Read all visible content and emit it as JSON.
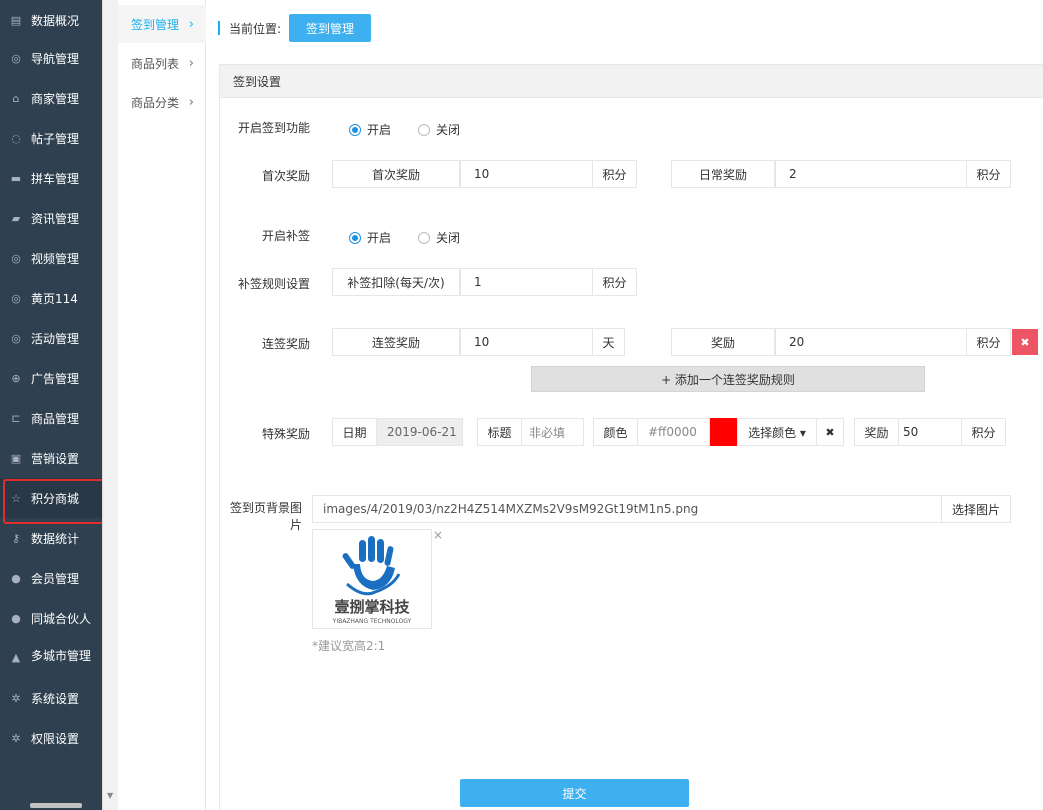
{
  "sidebar": {
    "items": [
      {
        "label": "数据概况",
        "icon": "dashboard-icon"
      },
      {
        "label": "导航管理",
        "icon": "compass-icon"
      },
      {
        "label": "商家管理",
        "icon": "bank-icon"
      },
      {
        "label": "帖子管理",
        "icon": "comment-icon"
      },
      {
        "label": "拼车管理",
        "icon": "car-icon"
      },
      {
        "label": "资讯管理",
        "icon": "book-icon"
      },
      {
        "label": "视频管理",
        "icon": "compass-icon"
      },
      {
        "label": "黄页114",
        "icon": "compass-icon"
      },
      {
        "label": "活动管理",
        "icon": "compass-icon"
      },
      {
        "label": "广告管理",
        "icon": "lifebuoy-icon"
      },
      {
        "label": "商品管理",
        "icon": "cart-icon"
      },
      {
        "label": "营销设置",
        "icon": "gift-icon"
      },
      {
        "label": "积分商城",
        "icon": "star-icon"
      },
      {
        "label": "数据统计",
        "icon": "key-icon"
      },
      {
        "label": "会员管理",
        "icon": "user-icon"
      },
      {
        "label": "同城合伙人",
        "icon": "users-icon"
      },
      {
        "label": "多城市管理",
        "icon": "graduation-icon"
      },
      {
        "label": "系统设置",
        "icon": "gear-icon"
      },
      {
        "label": "权限设置",
        "icon": "gear-icon"
      }
    ]
  },
  "subnav": {
    "items": [
      {
        "label": "签到管理"
      },
      {
        "label": "商品列表"
      },
      {
        "label": "商品分类"
      }
    ]
  },
  "crumb": {
    "label": "当前位置:",
    "current": "签到管理"
  },
  "panel": {
    "title": "签到设置"
  },
  "form": {
    "sign_enable": {
      "label": "开启签到功能",
      "on": "开启",
      "off": "关闭"
    },
    "first_reward": {
      "label": "首次奖励",
      "addon": "首次奖励",
      "value": "10",
      "unit": "积分"
    },
    "daily_reward": {
      "addon": "日常奖励",
      "value": "2",
      "unit": "积分"
    },
    "makeup_enable": {
      "label": "开启补签",
      "on": "开启",
      "off": "关闭"
    },
    "makeup_rule": {
      "label": "补签规则设置",
      "addon": "补签扣除(每天/次)",
      "value": "1",
      "unit": "积分"
    },
    "streak": {
      "label": "连签奖励",
      "addon": "连签奖励",
      "days": "10",
      "days_unit": "天",
      "reward_addon": "奖励",
      "reward": "20",
      "reward_unit": "积分",
      "delete": "✖"
    },
    "add_rule": "+ 添加一个连签奖励规则",
    "special": {
      "label": "特殊奖励",
      "date_addon": "日期",
      "date": "2019-06-21",
      "title_addon": "标题",
      "title_placeholder": "非必填",
      "color_addon": "颜色",
      "color_value": "#ff0000",
      "color_swatch": "#ff0000",
      "color_button": "选择颜色 ▾",
      "clear": "✖",
      "reward_addon": "奖励",
      "reward": "50",
      "reward_unit": "积分"
    },
    "bg_image": {
      "label_line1": "签到页背景图",
      "label_line2": "片",
      "path": "images/4/2019/03/nz2H4Z514MXZMs2V9sM92Gt19tM1n5.png",
      "button": "选择图片",
      "remove": "×",
      "logo_cn": "壹捌掌科技",
      "logo_en": "YIBAZHANG TECHNOLOGY",
      "tip": "*建议宽高2:1"
    },
    "submit": "提交"
  },
  "colors": {
    "sidebar_bg": "#2f4050",
    "accent": "#3fb0ef",
    "danger": "#ed5565",
    "highlight": "#e22d2d"
  }
}
